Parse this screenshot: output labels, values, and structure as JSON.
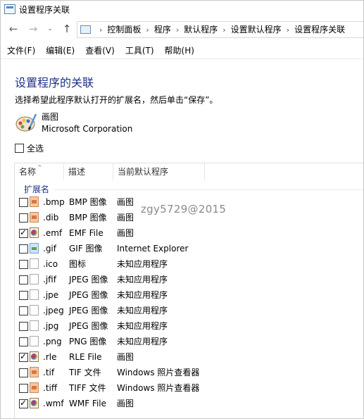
{
  "window": {
    "title": "设置程序关联"
  },
  "breadcrumbs": [
    "控制面板",
    "程序",
    "默认程序",
    "设置默认程序",
    "设置程序关联"
  ],
  "nav": {
    "back": "←",
    "forward": "→",
    "recent": "⌄",
    "up": "↑"
  },
  "menu": [
    "文件(F)",
    "编辑(E)",
    "查看(V)",
    "工具(T)",
    "帮助(H)"
  ],
  "page": {
    "heading": "设置程序的关联",
    "instructions": "选择希望此程序默认打开的扩展名，然后单击“保存”。",
    "app_name": "画图",
    "app_company": "Microsoft Corporation",
    "select_all_label": "全选"
  },
  "list": {
    "columns": [
      "名称",
      "描述",
      "当前默认程序"
    ],
    "group_label": "扩展名",
    "rows": [
      {
        "ext": ".bmp",
        "desc": "BMP 图像",
        "program": "画图",
        "checked": false,
        "icon": "bmp"
      },
      {
        "ext": ".dib",
        "desc": "BMP 图像",
        "program": "画图",
        "checked": false,
        "icon": "bmp"
      },
      {
        "ext": ".emf",
        "desc": "EMF File",
        "program": "画图",
        "checked": true,
        "icon": "paint"
      },
      {
        "ext": ".gif",
        "desc": "GIF 图像",
        "program": "Internet Explorer",
        "checked": false,
        "icon": "gif"
      },
      {
        "ext": ".ico",
        "desc": "图标",
        "program": "未知应用程序",
        "checked": false,
        "icon": "blank"
      },
      {
        "ext": ".jfif",
        "desc": "JPEG 图像",
        "program": "未知应用程序",
        "checked": false,
        "icon": "blank"
      },
      {
        "ext": ".jpe",
        "desc": "JPEG 图像",
        "program": "未知应用程序",
        "checked": false,
        "icon": "blank"
      },
      {
        "ext": ".jpeg",
        "desc": "JPEG 图像",
        "program": "未知应用程序",
        "checked": false,
        "icon": "blank"
      },
      {
        "ext": ".jpg",
        "desc": "JPEG 图像",
        "program": "未知应用程序",
        "checked": false,
        "icon": "blank"
      },
      {
        "ext": ".png",
        "desc": "PNG 图像",
        "program": "未知应用程序",
        "checked": false,
        "icon": "blank"
      },
      {
        "ext": ".rle",
        "desc": "RLE File",
        "program": "画图",
        "checked": true,
        "icon": "paint"
      },
      {
        "ext": ".tif",
        "desc": "TIF 文件",
        "program": "Windows 照片查看器",
        "checked": false,
        "icon": "bmp"
      },
      {
        "ext": ".tiff",
        "desc": "TIFF 文件",
        "program": "Windows 照片查看器",
        "checked": false,
        "icon": "bmp"
      },
      {
        "ext": ".wmf",
        "desc": "WMF File",
        "program": "画图",
        "checked": true,
        "icon": "paint"
      }
    ]
  },
  "watermark": "zgy5729@2015"
}
